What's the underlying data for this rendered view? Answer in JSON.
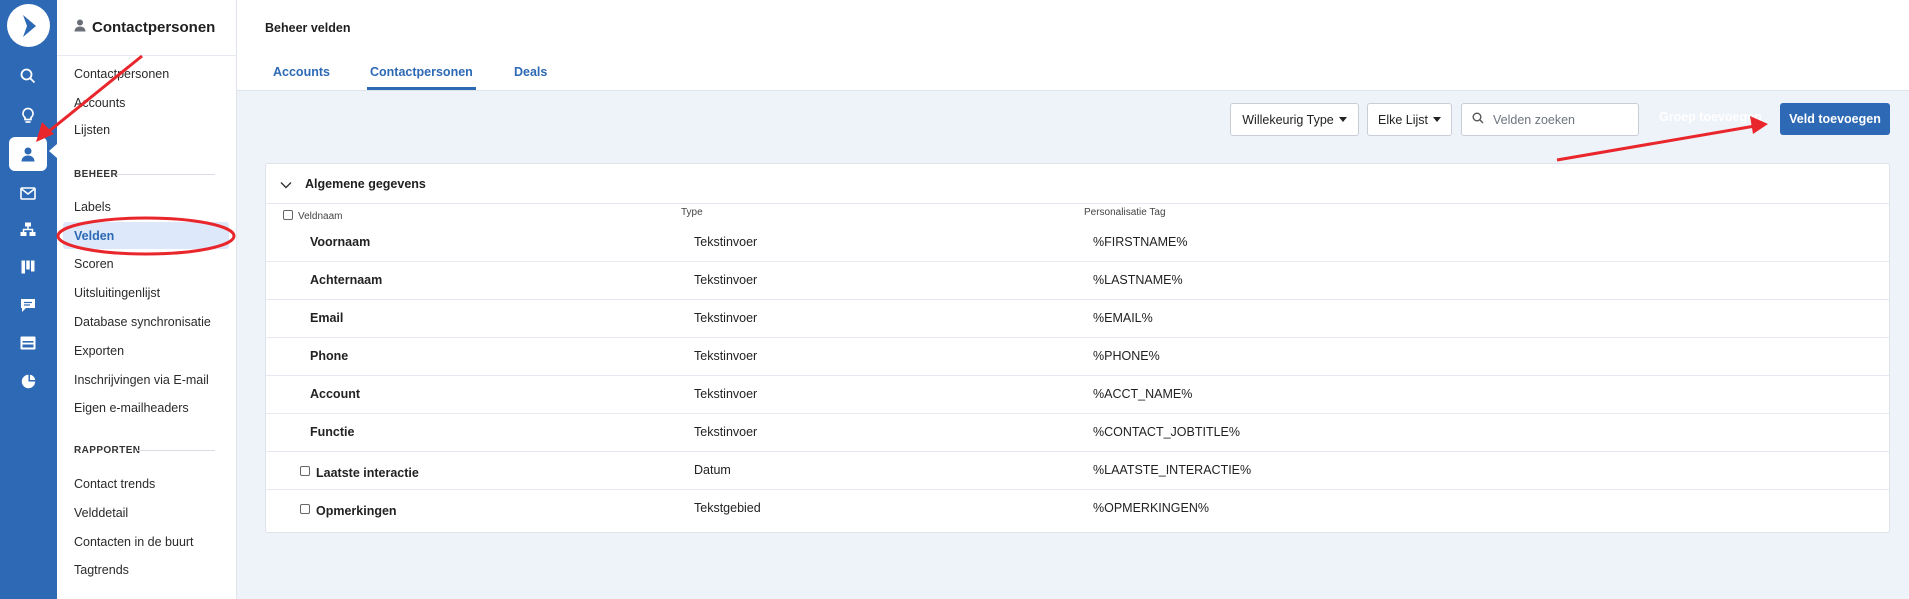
{
  "sidebar": {
    "title": "Contactpersonen",
    "links_top": [
      "Contactpersonen",
      "Accounts",
      "Lijsten"
    ],
    "section_beheer": "BEHEER",
    "links_beheer": [
      "Labels",
      "Velden",
      "Scoren",
      "Uitsluitingenlijst",
      "Database synchronisatie",
      "Exporten",
      "Inschrijvingen via E-mail",
      "Eigen e-mailheaders"
    ],
    "section_rapporten": "RAPPORTEN",
    "links_rapporten": [
      "Contact trends",
      "Velddetail",
      "Contacten in de buurt",
      "Tagtrends"
    ]
  },
  "header": {
    "title": "Beheer velden",
    "tabs": [
      "Accounts",
      "Contactpersonen",
      "Deals"
    ]
  },
  "toolbar": {
    "type_filter": "Willekeurig Type",
    "list_filter": "Elke Lijst",
    "search_placeholder": "Velden zoeken",
    "group_label": "Groep toevoegen",
    "add_field": "Veld toevoegen"
  },
  "table": {
    "group_title": "Algemene gegevens",
    "columns": [
      "Veldnaam",
      "Type",
      "Personalisatie Tag"
    ],
    "rows": [
      {
        "name": "Voornaam",
        "type": "Tekstinvoer",
        "tag": "%FIRSTNAME%",
        "checkbox": false
      },
      {
        "name": "Achternaam",
        "type": "Tekstinvoer",
        "tag": "%LASTNAME%",
        "checkbox": false
      },
      {
        "name": "Email",
        "type": "Tekstinvoer",
        "tag": "%EMAIL%",
        "checkbox": false
      },
      {
        "name": "Phone",
        "type": "Tekstinvoer",
        "tag": "%PHONE%",
        "checkbox": false
      },
      {
        "name": "Account",
        "type": "Tekstinvoer",
        "tag": "%ACCT_NAME%",
        "checkbox": false
      },
      {
        "name": "Functie",
        "type": "Tekstinvoer",
        "tag": "%CONTACT_JOBTITLE%",
        "checkbox": false
      },
      {
        "name": "Laatste interactie",
        "type": "Datum",
        "tag": "%LAATSTE_INTERACTIE%",
        "checkbox": true
      },
      {
        "name": "Opmerkingen",
        "type": "Tekstgebied",
        "tag": "%OPMERKINGEN%",
        "checkbox": true
      }
    ]
  },
  "colors": {
    "brand": "#2d69b4",
    "annotation": "#e8262b",
    "active_bg": "#dde9fa"
  },
  "icons": [
    "logo-icon",
    "search-icon",
    "lightbulb-icon",
    "contacts-icon",
    "envelope-icon",
    "automation-icon",
    "pipeline-icon",
    "chat-icon",
    "website-icon",
    "reports-icon",
    "person-icon",
    "chevron-down-icon"
  ]
}
